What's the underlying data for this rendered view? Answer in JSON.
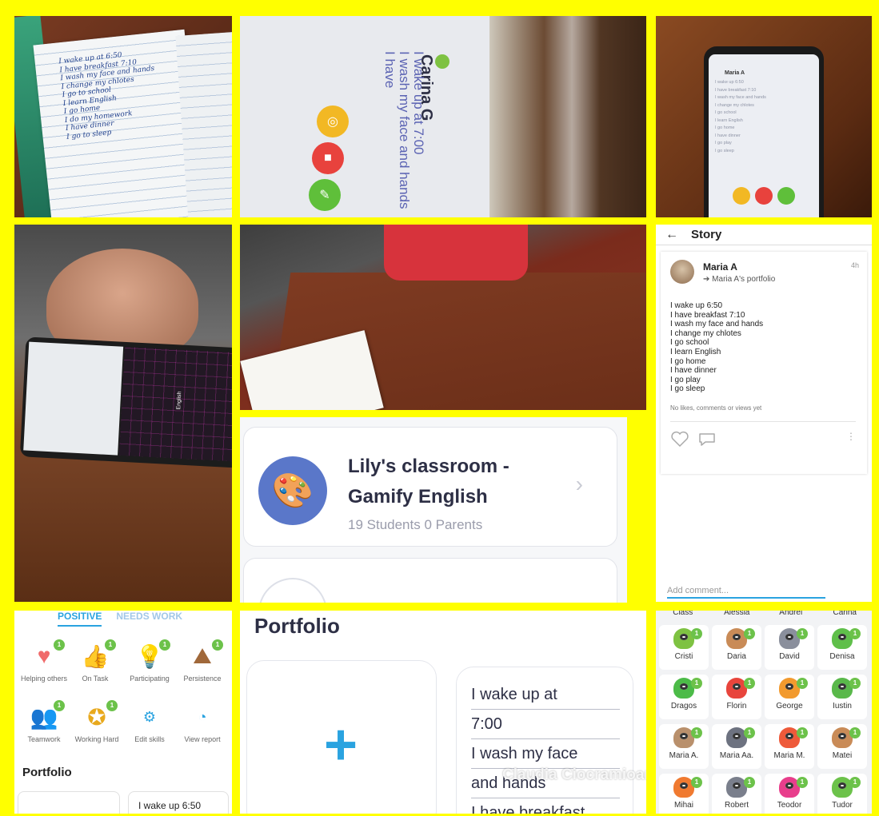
{
  "notebook": {
    "lines": [
      "I wake up at 6:50",
      "I have breakfast 7:10",
      "I wash my face and hands",
      "I change my chlotes",
      "I go to school",
      "I learn English",
      "I go home",
      "I do my homework",
      "I have dinner",
      "I go to sleep"
    ]
  },
  "tablet": {
    "student_name": "Carina G",
    "text_lines": [
      "I wake up at 7:00",
      "I wash my face and hands",
      "I have"
    ]
  },
  "phone": {
    "student_name": "Maria A",
    "lines": [
      "I wake up 6:50",
      "I have breakfast 7:10",
      "I wash my face and hands",
      "I change my chlotes",
      "I go school",
      "I learn English",
      "I go home",
      "I have dinner",
      "I go play",
      "I go sleep"
    ]
  },
  "hand_phone": {
    "keyboard_label": "English"
  },
  "story": {
    "title": "Story",
    "author": "Maria A",
    "time": "4h",
    "portfolio_link": "Maria A's portfolio",
    "lines": [
      "I wake up 6:50",
      "I have breakfast 7:10",
      "I wash my face and hands",
      "I change my chlotes",
      "I go school",
      "I learn English",
      "I go home",
      "I have dinner",
      "I go play",
      "I go sleep"
    ],
    "meta": "No likes, comments or views yet",
    "comment_placeholder": "Add comment..."
  },
  "classroom": {
    "title": "Lily's classroom - Gamify English",
    "subtitle": "19 Students 0 Parents"
  },
  "skills": {
    "tab_positive": "POSITIVE",
    "tab_needs_work": "NEEDS WORK",
    "items": [
      {
        "label": "Helping others",
        "badge": "1"
      },
      {
        "label": "On Task",
        "badge": "1"
      },
      {
        "label": "Participating",
        "badge": "1"
      },
      {
        "label": "Persistence",
        "badge": "1"
      },
      {
        "label": "Teamwork",
        "badge": "1"
      },
      {
        "label": "Working Hard",
        "badge": "1"
      },
      {
        "label": "Edit skills",
        "badge": ""
      },
      {
        "label": "View report",
        "badge": ""
      }
    ],
    "portfolio_heading": "Portfolio",
    "portfolio_preview": "I wake up 6:50"
  },
  "portfolio": {
    "title": "Portfolio",
    "add_symbol": "+",
    "lines": [
      "I wake up at",
      "7:00",
      "I wash my face",
      "and hands",
      "I have breakfast"
    ],
    "watermark": "Claudia Ciocramioara PHOTOGRID"
  },
  "students": {
    "top_row": [
      "Class",
      "Alessia",
      "Andrei",
      "Carina"
    ],
    "grid": [
      {
        "name": "Cristi",
        "color": "#7ec242"
      },
      {
        "name": "Daria",
        "color": "#c98b57"
      },
      {
        "name": "David",
        "color": "#8a8f9c"
      },
      {
        "name": "Denisa",
        "color": "#5fbf4a"
      },
      {
        "name": "Dragos",
        "color": "#4cbb48"
      },
      {
        "name": "Florin",
        "color": "#e8453c"
      },
      {
        "name": "George",
        "color": "#f29a2e"
      },
      {
        "name": "Iustin",
        "color": "#59b84a"
      },
      {
        "name": "Maria A.",
        "color": "#b9906c"
      },
      {
        "name": "Maria Aa.",
        "color": "#6d7280"
      },
      {
        "name": "Maria M.",
        "color": "#ee5a3a"
      },
      {
        "name": "Matei",
        "color": "#c98b57"
      },
      {
        "name": "Mihai",
        "color": "#f07a30"
      },
      {
        "name": "Robert",
        "color": "#7a7f8c"
      },
      {
        "name": "Teodor",
        "color": "#e83e8c"
      },
      {
        "name": "Tudor",
        "color": "#6cc24a"
      }
    ],
    "badge": "1"
  }
}
